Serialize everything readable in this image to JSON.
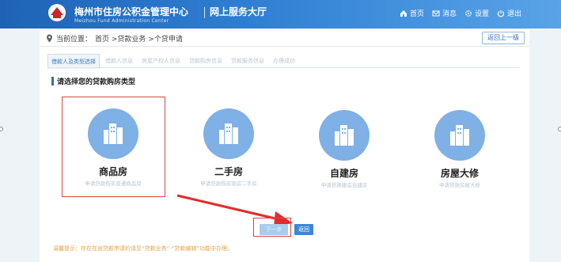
{
  "header": {
    "org_title": "梅州市住房公积金管理中心",
    "org_subtitle": "Meizhou Fund Administration Center",
    "hall_title": "网上服务大厅",
    "nav": [
      {
        "label": "首页",
        "icon": "home-icon"
      },
      {
        "label": "消息",
        "icon": "message-icon"
      },
      {
        "label": "设置",
        "icon": "gear-icon"
      },
      {
        "label": "退出",
        "icon": "power-icon"
      }
    ],
    "brand_color": "#1e63b6"
  },
  "breadcrumb": {
    "prefix": "当前位置：",
    "path": "首页 >贷款业务 >个贷申请",
    "back_label": "返回上一级"
  },
  "tabs": [
    {
      "label": "借款人及类型选择",
      "active": true
    },
    {
      "label": "借款人信息",
      "active": false
    },
    {
      "label": "房屋产权人信息",
      "active": false
    },
    {
      "label": "贷款购房信息",
      "active": false
    },
    {
      "label": "贷款服务信息",
      "active": false
    },
    {
      "label": "办理成功",
      "active": false
    }
  ],
  "section_title": "请选择您的贷款购房类型",
  "cards": [
    {
      "name": "商品房",
      "desc": "申请贷款购买普通商品房",
      "selected": true
    },
    {
      "name": "二手房",
      "desc": "申请贷款购买现房二手房",
      "selected": false
    },
    {
      "name": "自建房",
      "desc": "申请贷款建造自建房",
      "selected": false
    },
    {
      "name": "房屋大修",
      "desc": "申请贷款房屋大修",
      "selected": false
    }
  ],
  "buttons": {
    "next_label": "下一步",
    "return_label": "返回"
  },
  "tip": "温馨提示：存在在途贷款申请的请至“贷款业务”-“贷款编辑”功能中办理。",
  "colors": {
    "accent": "#2f6fb9",
    "highlight": "#e04444",
    "card_circle": "#7fb0e6",
    "tip": "#e6a34a"
  }
}
